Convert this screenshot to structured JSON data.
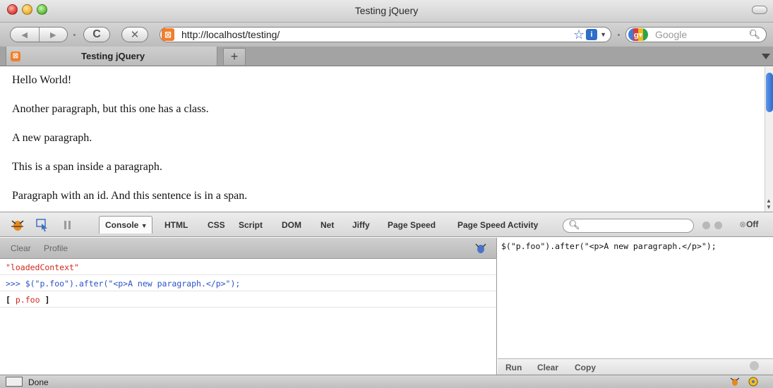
{
  "window": {
    "title": "Testing jQuery"
  },
  "nav": {
    "url": "http://localhost/testing/",
    "search_placeholder": "Google",
    "reload_glyph": "C",
    "stop_glyph": "✕"
  },
  "tabs": [
    {
      "label": "Testing jQuery"
    }
  ],
  "content": {
    "paragraphs": [
      "Hello World!",
      "Another paragraph, but this one has a class.",
      "A new paragraph.",
      "This is a span inside a paragraph.",
      "Paragraph with an id. And this sentence is in a span."
    ]
  },
  "firebug": {
    "tabs": [
      "Console",
      "HTML",
      "CSS",
      "Script",
      "DOM",
      "Net",
      "Jiffy",
      "Page Speed",
      "Page Speed Activity"
    ],
    "off_label": "Off",
    "console": {
      "clear_label": "Clear",
      "profile_label": "Profile",
      "log": {
        "string_entry": "\"loadedContext\"",
        "command": ">>> $(\"p.foo\").after(\"<p>A new paragraph.</p>\");",
        "result_open": "[",
        "result_value": "p.foo",
        "result_close": "]"
      }
    },
    "editor": {
      "code": "$(\"p.foo\").after(\"<p>A new paragraph.</p>\");",
      "run_label": "Run",
      "clear_label": "Clear",
      "copy_label": "Copy"
    }
  },
  "status": {
    "text": "Done"
  },
  "colors": {
    "error_red": "#d3261d",
    "command_blue": "#2a52c9",
    "scroll_blue": "#2d6bd0"
  }
}
